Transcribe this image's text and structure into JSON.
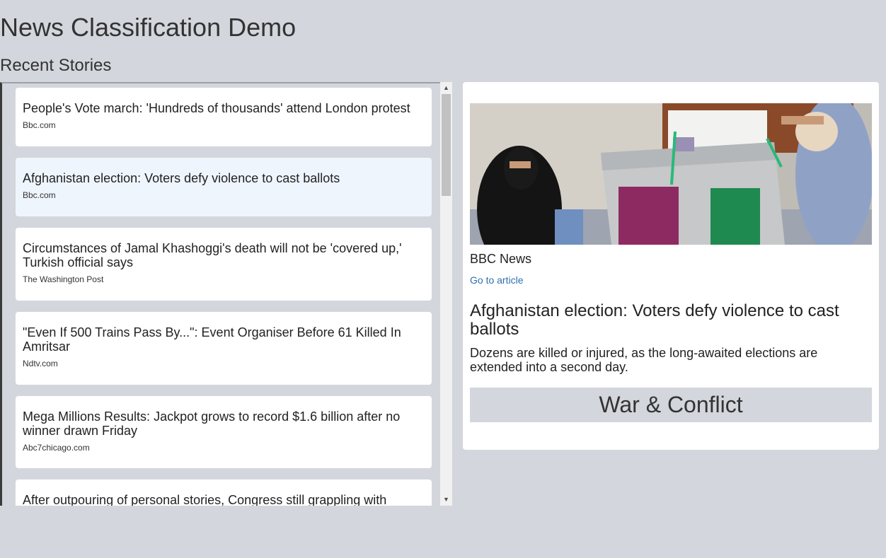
{
  "header": {
    "title": "News Classification Demo",
    "section_title": "Recent Stories"
  },
  "stories": [
    {
      "title": "People's Vote march: 'Hundreds of thousands' attend London protest",
      "source": "Bbc.com"
    },
    {
      "title": "Afghanistan election: Voters defy violence to cast ballots",
      "source": "Bbc.com"
    },
    {
      "title": "Circumstances of Jamal Khashoggi's death will not be 'covered up,' Turkish official says",
      "source": "The Washington Post"
    },
    {
      "title": "\"Even If 500 Trains Pass By...\": Event Organiser Before 61 Killed In Amritsar",
      "source": "Ndtv.com"
    },
    {
      "title": "Mega Millions Results: Jackpot grows to record $1.6 billion after no winner drawn Friday",
      "source": "Abc7chicago.com"
    },
    {
      "title": "After outpouring of personal stories, Congress still grappling with",
      "source": ""
    }
  ],
  "detail": {
    "source": "BBC News",
    "link_text": "Go to article",
    "title": "Afghanistan election: Voters defy violence to cast ballots",
    "description": "Dozens are killed or injured, as the long-awaited elections are extended into a second day.",
    "category": "War & Conflict"
  },
  "scrollbar": {
    "up_icon": "chevron-up-icon",
    "down_icon": "chevron-down-icon"
  },
  "colors": {
    "background": "#d3d6dc",
    "card": "#ffffff",
    "selected_card": "#eef5fd",
    "link": "#2f6fb0"
  }
}
